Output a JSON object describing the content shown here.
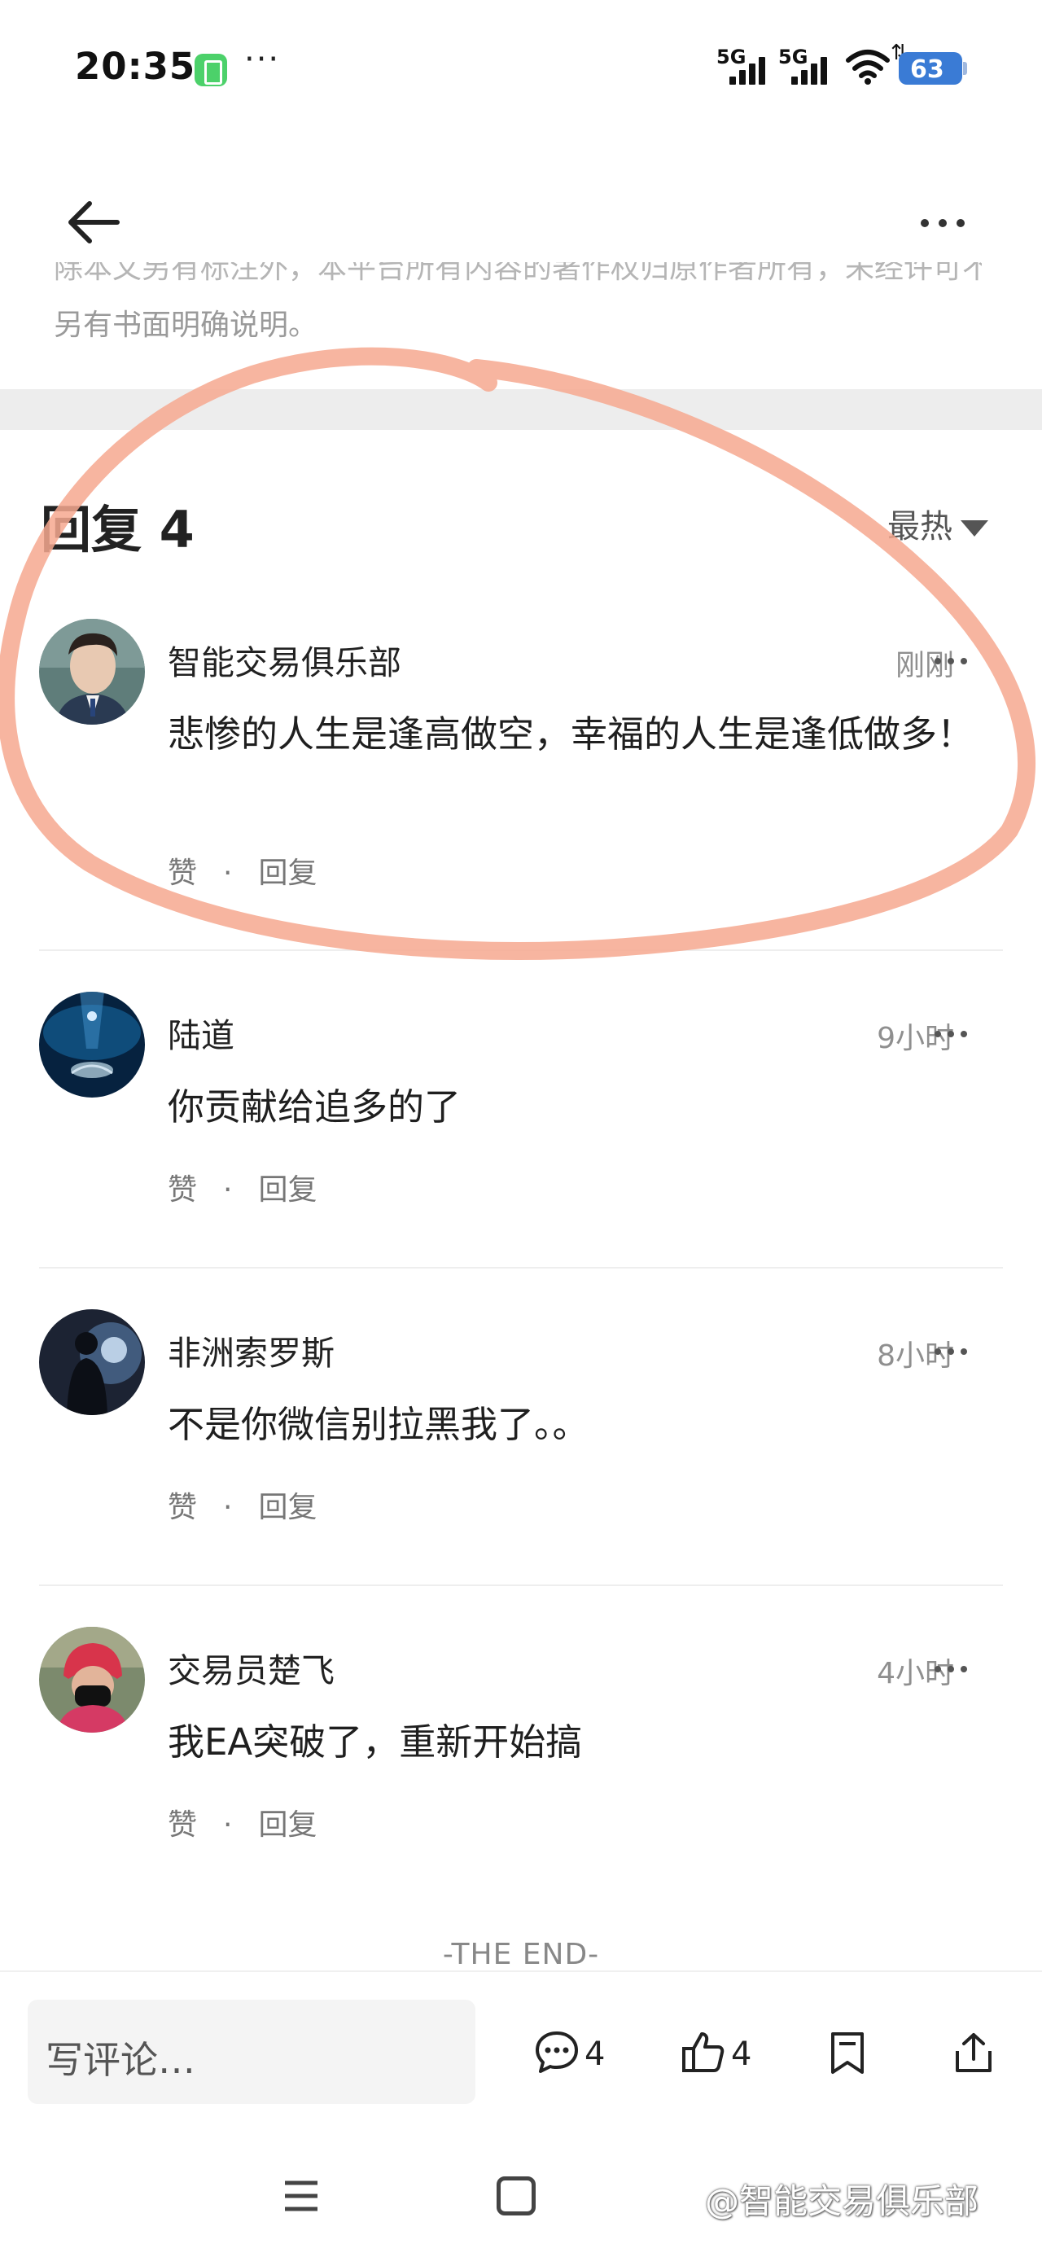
{
  "status_bar": {
    "time": "20:35",
    "dots": "···",
    "signal_1": "5G",
    "signal_2": "5G",
    "battery": "63"
  },
  "article": {
    "tail_text": "另有书面明确说明。",
    "cut_text": "除本文另有标注外，本平台所有内容的著作权归原作者所有，未经许可不得转载，除另"
  },
  "replies": {
    "title": "回复 4",
    "sort_label": "最热"
  },
  "comments": [
    {
      "name": "智能交易俱乐部",
      "time": "刚刚",
      "text": "悲惨的人生是逢高做空，幸福的人生是逢低做多！",
      "like_label": "赞",
      "sep": "·",
      "reply_label": "回复"
    },
    {
      "name": "陆道",
      "time": "9小时",
      "text": "你贡献给追多的了",
      "like_label": "赞",
      "sep": "·",
      "reply_label": "回复"
    },
    {
      "name": "非洲索罗斯",
      "time": "8小时",
      "text": "不是你微信别拉黑我了。。",
      "like_label": "赞",
      "sep": "·",
      "reply_label": "回复"
    },
    {
      "name": "交易员楚飞",
      "time": "4小时",
      "text": "我EA突破了，重新开始搞",
      "like_label": "赞",
      "sep": "·",
      "reply_label": "回复"
    }
  ],
  "end_label": "-THE END-",
  "bottom_bar": {
    "input_placeholder": "写评论…",
    "comment_count": "4",
    "like_count": "4"
  },
  "watermark": "@智能交易俱乐部",
  "icons": {
    "back": "back-arrow-icon",
    "more": "more-dots-icon",
    "comment": "comment-bubble-icon",
    "like": "thumbs-up-icon",
    "bookmark": "bookmark-icon",
    "share": "share-icon",
    "nav_menu": "menu-icon",
    "nav_home": "home-square-icon"
  },
  "colors": {
    "annotation": "#f6a88f",
    "battery": "#3a7bd5",
    "muted_text": "#8f8f8f"
  }
}
